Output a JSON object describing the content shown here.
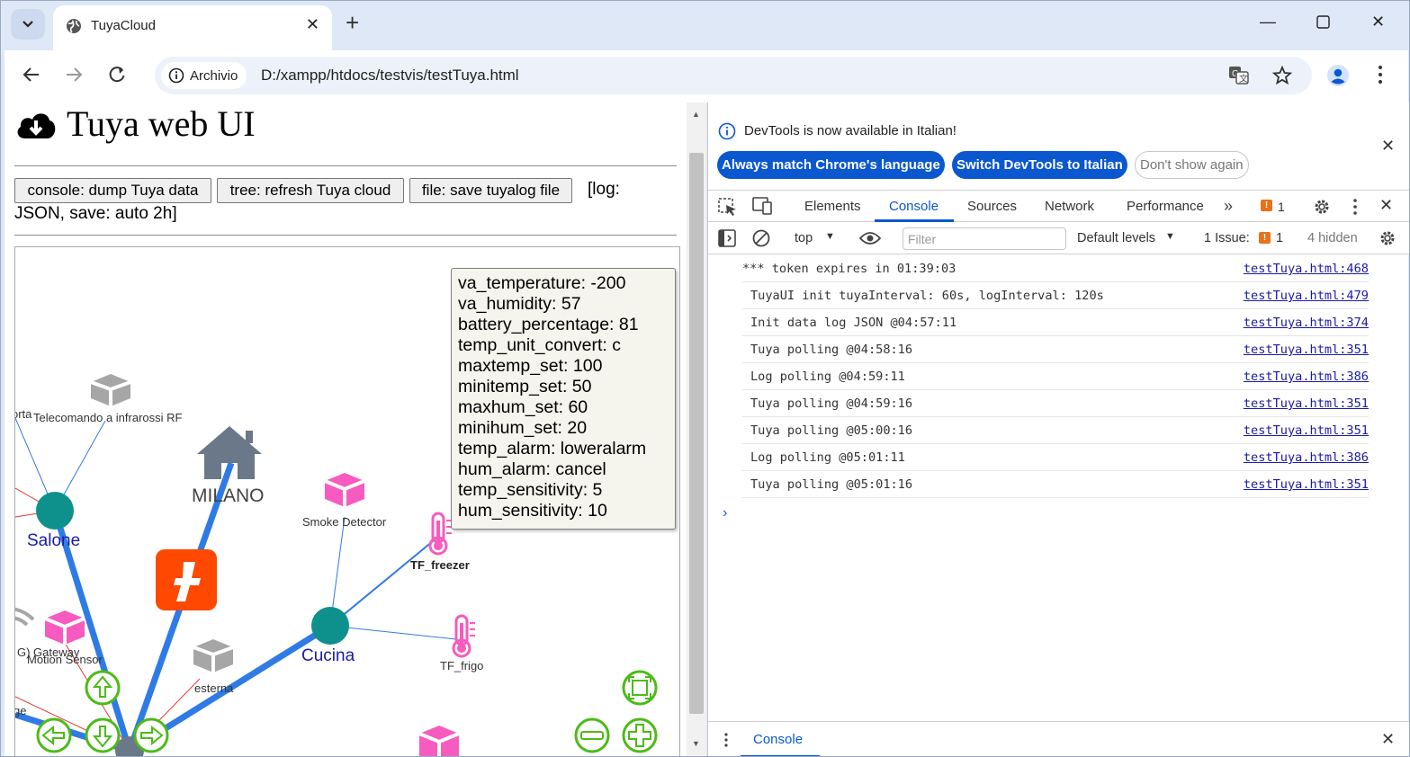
{
  "browser": {
    "tab_title": "TuyaCloud",
    "new_tab_label": "+",
    "security_chip": "Archivio",
    "url": "D:/xampp/htdocs/testvis/testTuya.html"
  },
  "page": {
    "title": "Tuya web UI",
    "buttons": {
      "dump": "console: dump Tuya data",
      "refresh": "tree: refresh Tuya cloud",
      "save": "file: save tuyalog file"
    },
    "log_info_line1": "[log:",
    "log_info_line2": "JSON, save: auto 2h]"
  },
  "graph": {
    "nodes": {
      "porta": "orta",
      "telecomando": "Telecomando a infrarossi RF",
      "milano": "MILANO",
      "salone": "Salone",
      "smoke": "Smoke Detector",
      "tf_freezer": "TF_freezer",
      "cucina": "Cucina",
      "tf_frigo": "TF_frigo",
      "gateway": "G) Gateway",
      "motion": "Motion Sensor",
      "esterna": "esterna",
      "ge": "ge"
    },
    "tooltip": [
      "va_temperature: -200",
      "va_humidity: 57",
      "battery_percentage: 81",
      "temp_unit_convert: c",
      "maxtemp_set: 100",
      "minitemp_set: 50",
      "maxhum_set: 60",
      "minihum_set: 20",
      "temp_alarm: loweralarm",
      "hum_alarm: cancel",
      "temp_sensitivity: 5",
      "hum_sensitivity: 10"
    ],
    "colors": {
      "edge_blue": "#2f7be6",
      "edge_red": "#e53935",
      "room_node": "#0e918c",
      "room_label": "#1a1aa6",
      "house_icon": "#6a7889",
      "device_pink": "#f75bbf",
      "device_grey": "#a6a6a6",
      "tuya_logo": "#ff4800",
      "nav_green": "#4cbb17"
    }
  },
  "devtools": {
    "info_text": "DevTools is now available in Italian!",
    "btn_match": "Always match Chrome's language",
    "btn_switch": "Switch DevTools to Italian",
    "btn_dont_show": "Don't show again",
    "tabs": [
      "Elements",
      "Console",
      "Sources",
      "Network",
      "Performance"
    ],
    "issues_badge": "1",
    "context": "top",
    "filter_placeholder": "Filter",
    "levels": "Default levels",
    "issue_label": "1 Issue:",
    "issue_count": "1",
    "hidden": "4 hidden",
    "logs": [
      {
        "msg": "*** token expires in 01:39:03",
        "src": "testTuya.html:468"
      },
      {
        "msg": "TuyaUI init tuyaInterval: 60s, logInterval: 120s",
        "src": "testTuya.html:479"
      },
      {
        "msg": "Init data log JSON @04:57:11",
        "src": "testTuya.html:374"
      },
      {
        "msg": "Tuya polling @04:58:16",
        "src": "testTuya.html:351"
      },
      {
        "msg": "Log polling @04:59:11",
        "src": "testTuya.html:386"
      },
      {
        "msg": "Tuya polling @04:59:16",
        "src": "testTuya.html:351"
      },
      {
        "msg": "Tuya polling @05:00:16",
        "src": "testTuya.html:351"
      },
      {
        "msg": "Log polling @05:01:11",
        "src": "testTuya.html:386"
      },
      {
        "msg": "Tuya polling @05:01:16",
        "src": "testTuya.html:351"
      }
    ],
    "drawer_tab": "Console"
  }
}
